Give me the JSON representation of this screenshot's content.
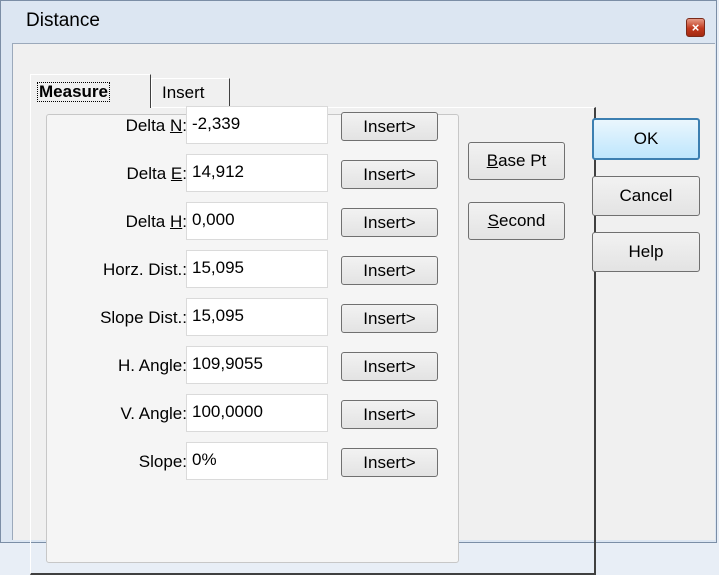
{
  "window": {
    "title": "Distance",
    "close_glyph": "×"
  },
  "tabs": [
    {
      "label": "Measure",
      "active": true
    },
    {
      "label": "Insert",
      "active": false
    }
  ],
  "fields": [
    {
      "label_pre": "Delta ",
      "label_key": "N",
      "label_post": ":",
      "value": "-2,339",
      "button": "Insert>"
    },
    {
      "label_pre": "Delta ",
      "label_key": "E",
      "label_post": ":",
      "value": "14,912",
      "button": "Insert>"
    },
    {
      "label_pre": "Delta ",
      "label_key": "H",
      "label_post": ":",
      "value": "0,000",
      "button": "Insert>"
    },
    {
      "label_pre": "Horz. Dist.:",
      "label_key": "",
      "label_post": "",
      "value": "15,095",
      "button": "Insert>"
    },
    {
      "label_pre": "Slope Dist.:",
      "label_key": "",
      "label_post": "",
      "value": "15,095",
      "button": "Insert>"
    },
    {
      "label_pre": "H. Angle:",
      "label_key": "",
      "label_post": "",
      "value": "109,9055",
      "button": "Insert>"
    },
    {
      "label_pre": "V. Angle:",
      "label_key": "",
      "label_post": "",
      "value": "100,0000",
      "button": "Insert>"
    },
    {
      "label_pre": "Slope:",
      "label_key": "",
      "label_post": "",
      "value": "0%",
      "button": "Insert>"
    }
  ],
  "point_buttons": {
    "base_key": "B",
    "base_rest": "ase Pt",
    "second_key": "S",
    "second_rest": "econd"
  },
  "dialog_buttons": {
    "ok": "OK",
    "cancel": "Cancel",
    "help": "Help"
  },
  "colors": {
    "frame": "#dce6f2",
    "client": "#f0f0f0",
    "close": "#c2391e",
    "default_button_border": "#3c7fb1"
  },
  "icons": {
    "close": "close-icon"
  }
}
